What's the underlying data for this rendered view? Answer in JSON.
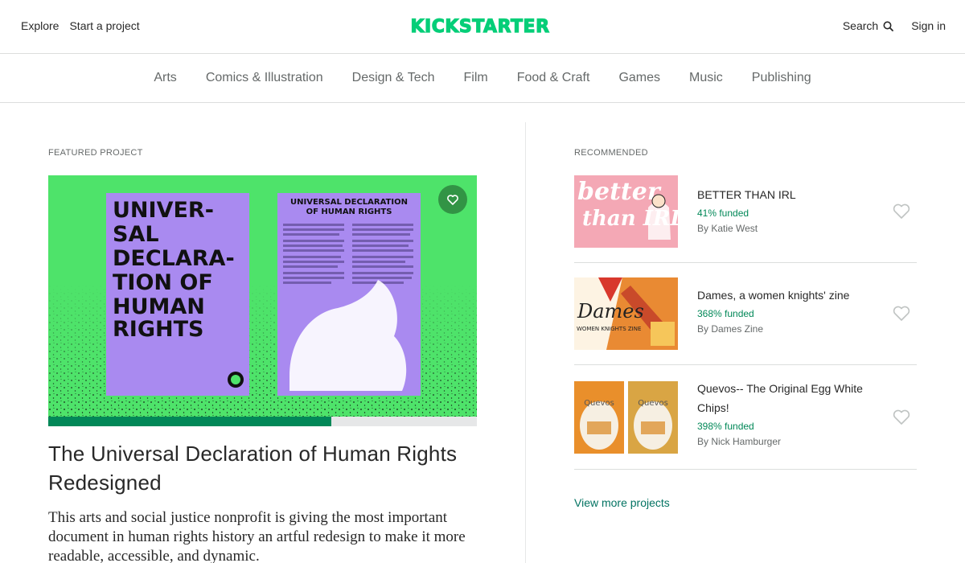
{
  "header": {
    "explore_label": "Explore",
    "start_label": "Start a project",
    "logo_text": "KICKSTARTER",
    "search_label": "Search",
    "signin_label": "Sign in",
    "brand_color": "#05ce78"
  },
  "categories": [
    "Arts",
    "Comics & Illustration",
    "Design & Tech",
    "Film",
    "Food & Craft",
    "Games",
    "Music",
    "Publishing"
  ],
  "featured": {
    "section_label": "FEATURED PROJECT",
    "title": "The Universal Declaration of Human Rights Redesigned",
    "blurb": "This arts and social justice nonprofit is giving the most important document in human rights history an artful redesign to make it more readable, accessible, and dynamic.",
    "funded_fraction": 0.66,
    "image_text_left": "UNIVER-SAL DECLARA-TION OF HUMAN RIGHTS",
    "image_text_right": "UNIVERSAL DECLARATION OF HUMAN RIGHTS"
  },
  "recommended": {
    "section_label": "RECOMMENDED",
    "items": [
      {
        "title": "BETTER THAN IRL",
        "funded": "41% funded",
        "by": "By Katie West",
        "thumb_text": "better than IRL"
      },
      {
        "title": "Dames, a women knights' zine",
        "funded": "368% funded",
        "by": "By Dames Zine",
        "thumb_text": "Dames"
      },
      {
        "title": "Quevos-- The Original Egg White Chips!",
        "funded": "398% funded",
        "by": "By Nick Hamburger",
        "thumb_text": "Quevos"
      }
    ],
    "view_more_label": "View more projects"
  },
  "colors": {
    "funded_green": "#028858",
    "progress_track": "#e6e7e8",
    "featured_bg": "#4ee36a",
    "poster_purple": "#a98af0"
  }
}
